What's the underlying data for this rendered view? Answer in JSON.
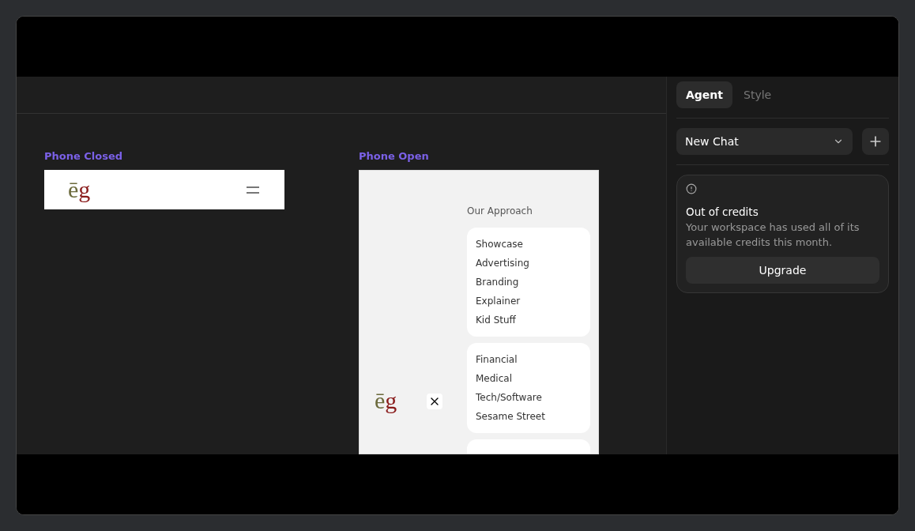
{
  "canvas": {
    "frames": [
      {
        "kind": "closed",
        "label": "Phone Closed",
        "logo": [
          {
            "text": "ē",
            "color": "#6b6a3c"
          },
          {
            "text": "g",
            "color": "#8a1c1c"
          }
        ]
      },
      {
        "kind": "open",
        "label": "Phone Open",
        "logo": [
          {
            "text": "ē",
            "color": "#6b6a3c"
          },
          {
            "text": "g",
            "color": "#8a1c1c"
          }
        ],
        "heading": "Our Approach",
        "groups": [
          [
            "Showcase",
            "Advertising",
            "Branding",
            "Explainer",
            "Kid Stuff"
          ],
          [
            "Financial",
            "Medical",
            "Tech/Software",
            "Sesame Street"
          ]
        ],
        "more_below": true
      }
    ]
  },
  "sidebar": {
    "tabs": [
      {
        "label": "Agent",
        "selected": true
      },
      {
        "label": "Style",
        "selected": false
      }
    ],
    "chat_select": {
      "value": "New Chat"
    },
    "notice": {
      "title": "Out of credits",
      "message": "Your workspace has used all of its available credits this month.",
      "button": "Upgrade"
    }
  }
}
